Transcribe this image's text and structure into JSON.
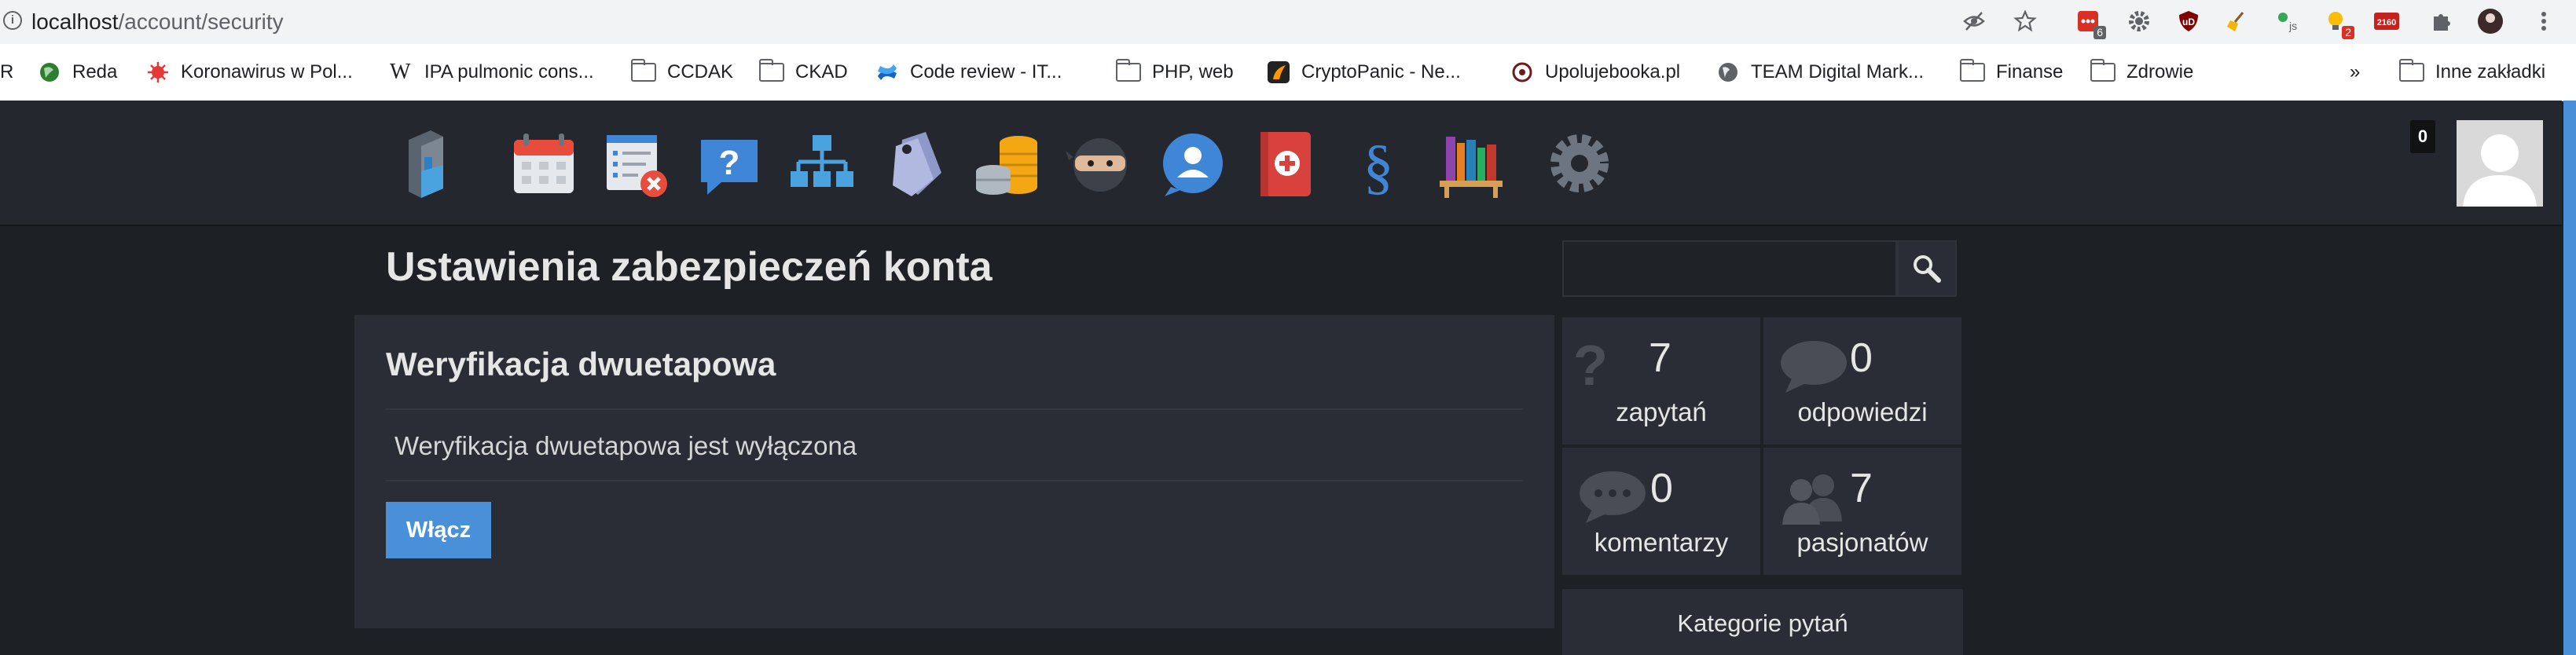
{
  "browser": {
    "url_host": "localhost",
    "url_path": "/account/security",
    "extension_badges": [
      "6",
      "2",
      "2160"
    ],
    "bookmarks": [
      {
        "label": "R",
        "icon": "none"
      },
      {
        "label": "Reda",
        "icon": "globe-icon"
      },
      {
        "label": "Koronawirus w Pol...",
        "icon": "virus-icon"
      },
      {
        "label": "IPA pulmonic cons...",
        "icon": "wikipedia-icon"
      },
      {
        "label": "CCDAK",
        "icon": "folder-icon"
      },
      {
        "label": "CKAD",
        "icon": "folder-icon"
      },
      {
        "label": "Code review - IT...",
        "icon": "confluence-icon"
      },
      {
        "label": "PHP, web",
        "icon": "folder-icon"
      },
      {
        "label": "CryptoPanic - Ne...",
        "icon": "cryptopanic-icon"
      },
      {
        "label": "Upolujebooka.pl",
        "icon": "upolujebooka-icon"
      },
      {
        "label": "TEAM Digital Mark...",
        "icon": "globe-icon"
      },
      {
        "label": "Finanse",
        "icon": "folder-icon"
      },
      {
        "label": "Zdrowie",
        "icon": "folder-icon"
      }
    ],
    "overflow_label": "»",
    "other_bookmarks": "Inne zakładki"
  },
  "nav": {
    "icons": [
      "logo-icon",
      "calendar-icon",
      "cancel-list-icon",
      "questions-icon",
      "hierarchy-icon",
      "tags-icon",
      "coins-icon",
      "ninja-icon",
      "user-chat-icon",
      "medical-icon",
      "law-icon",
      "library-icon",
      "settings-icon"
    ],
    "notification_count": "0",
    "accent": "#4a90d9"
  },
  "main": {
    "page_title": "Ustawienia zabezpieczeń konta",
    "section_title": "Weryfikacja dwuetapowa",
    "status_text": "Weryfikacja dwuetapowa jest wyłączona",
    "enable_label": "Włącz"
  },
  "sidebar": {
    "search_placeholder": "",
    "stats": [
      {
        "value": "7",
        "label": "zapytań",
        "icon": "question-icon"
      },
      {
        "value": "0",
        "label": "odpowiedzi",
        "icon": "speech-bubble-icon"
      },
      {
        "value": "0",
        "label": "komentarzy",
        "icon": "comments-icon"
      },
      {
        "value": "7",
        "label": "pasjonatów",
        "icon": "users-icon"
      }
    ],
    "categories_title": "Kategorie pytań"
  }
}
